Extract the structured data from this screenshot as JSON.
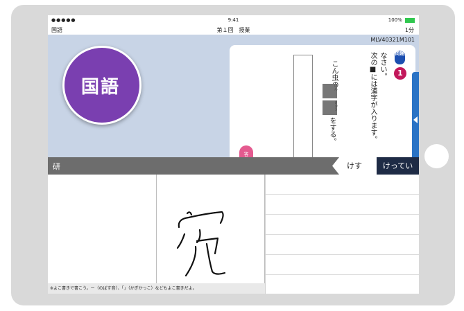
{
  "status_bar": {
    "signal": "●●●●● ",
    "time": "9:41",
    "battery": "100%"
  },
  "nav_bar": {
    "subject": "国語",
    "title": "第１回　授業",
    "timer": "1分"
  },
  "question": {
    "id": "MLV40321M101",
    "badge": "国語",
    "label": "問題",
    "number": "1",
    "instruction_line1": "次の■には漢字が入ります。",
    "instruction_line2": "なさい。",
    "sentence_start": "こん虫の",
    "ruby1": "けん",
    "ruby2": "きゅう",
    "sentence_end": "をする。",
    "tab_label": "答"
  },
  "candidate_bar": {
    "recognized": "研",
    "candidates": [
      "けす",
      "けってい"
    ]
  },
  "writing": {
    "note": "※よこ書きで書こう。ー（のばす音）、「」（かぎかっこ）などもよこ書きだよ。"
  },
  "colors": {
    "question_bg": "#c8d4e6",
    "badge": "#7a3fb0",
    "label_blue": "#1c4fb0",
    "number_red": "#c2185b",
    "candidate_selected": "#1e2b45",
    "toolbar_gray": "#6d6d6d",
    "side_tab": "#2a73c5"
  },
  "icons": {
    "side_tab": "chevron-left-icon",
    "battery": "battery-icon"
  }
}
